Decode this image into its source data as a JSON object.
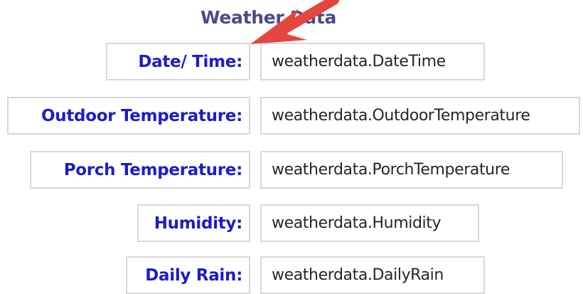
{
  "title": "Weather Data",
  "rows": [
    {
      "label": "Date/ Time:",
      "value": "weatherdata.DateTime"
    },
    {
      "label": "Outdoor Temperature:",
      "value": "weatherdata.OutdoorTemperature"
    },
    {
      "label": "Porch Temperature:",
      "value": "weatherdata.PorchTemperature"
    },
    {
      "label": "Humidity:",
      "value": "weatherdata.Humidity"
    },
    {
      "label": "Daily Rain:",
      "value": "weatherdata.DailyRain"
    }
  ],
  "colors": {
    "label": "#1c1cc8",
    "title": "#4a4a8c",
    "border": "#d8d8d8",
    "arrow": "#e3463c"
  }
}
